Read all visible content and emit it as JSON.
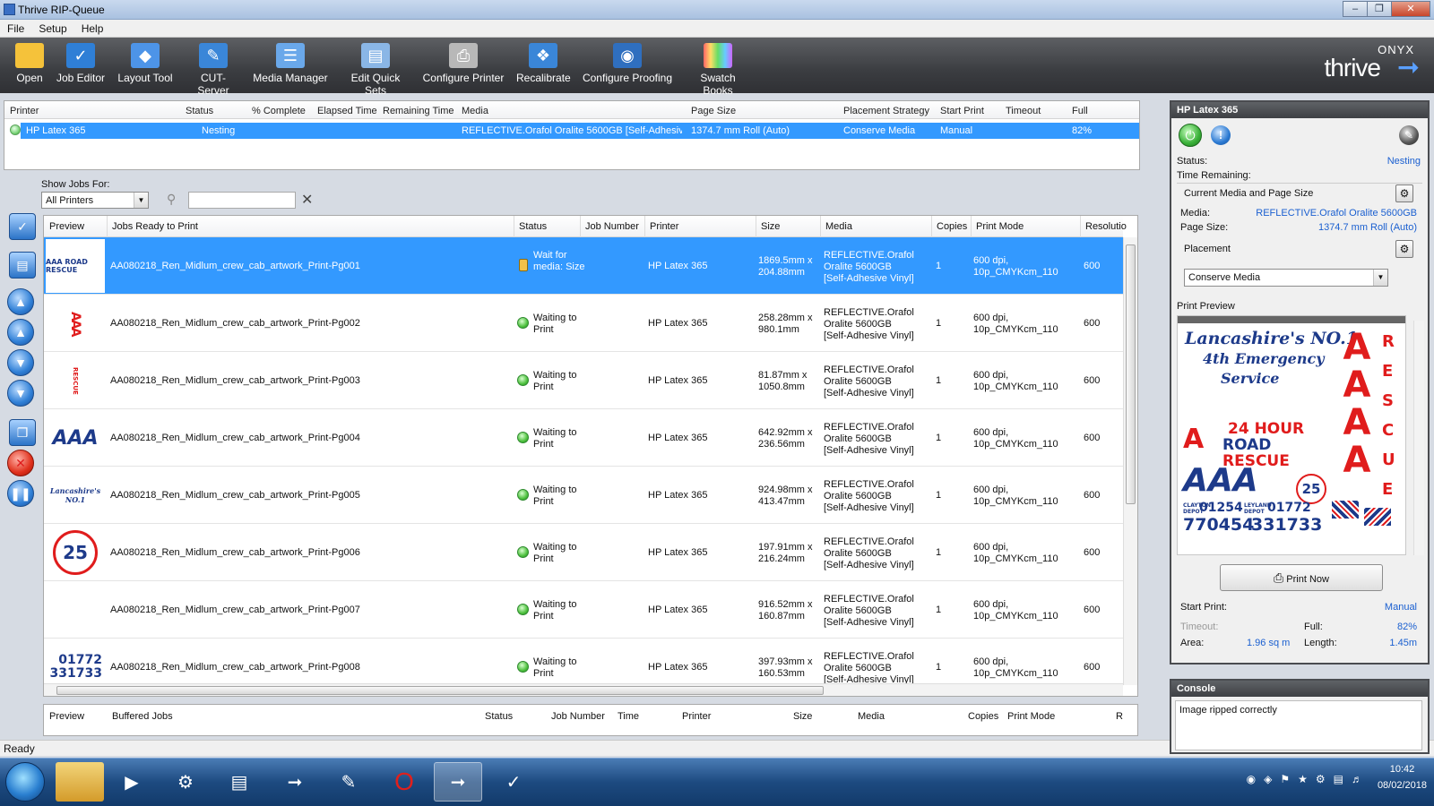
{
  "window": {
    "title": "Thrive RIP-Queue"
  },
  "menu": [
    "File",
    "Setup",
    "Help"
  ],
  "toolbar": [
    {
      "label": "Open",
      "icon": "folder-icon"
    },
    {
      "label": "Job Editor",
      "icon": "job-editor-icon"
    },
    {
      "label": "Layout Tool",
      "icon": "layout-tool-icon"
    },
    {
      "label": "CUT-Server",
      "icon": "cut-server-icon"
    },
    {
      "label": "Media Manager",
      "icon": "media-manager-icon"
    },
    {
      "label": "Edit Quick Sets",
      "icon": "quick-sets-icon"
    },
    {
      "label": "Configure Printer",
      "icon": "printer-icon"
    },
    {
      "label": "Recalibrate",
      "icon": "recalibrate-icon"
    },
    {
      "label": "Configure Proofing",
      "icon": "proofing-eye-icon"
    },
    {
      "label": "Swatch Books",
      "icon": "swatch-grid-icon"
    }
  ],
  "brand": {
    "onyx": "ONYX",
    "thrive": "thrive"
  },
  "printers": {
    "columns": [
      "Printer",
      "Status",
      "% Complete",
      "Elapsed Time",
      "Remaining Time",
      "Media",
      "Page Size",
      "Placement Strategy",
      "Start Print",
      "Timeout",
      "Full"
    ],
    "row": {
      "printer": "HP Latex 365",
      "status": "Nesting",
      "media": "REFLECTIVE.Orafol Oralite 5600GB [Self-Adhesiv...",
      "page_size": "1374.7 mm Roll (Auto)",
      "placement": "Conserve Media",
      "start_print": "Manual",
      "full": "82%"
    }
  },
  "filter": {
    "label": "Show Jobs For:",
    "selected": "All Printers",
    "search_value": ""
  },
  "jobs": {
    "columns": [
      "Preview",
      "Jobs Ready to Print",
      "Status",
      "Job Number",
      "Printer",
      "Size",
      "Media",
      "Copies",
      "Print Mode",
      "Resolutio"
    ],
    "rows": [
      {
        "name": "AA080218_Ren_Midlum_crew_cab_artwork_Print-Pg001",
        "status": "Wait for media: Size",
        "printer": "HP Latex 365",
        "size_1": "1869.5mm x",
        "size_2": "204.88mm",
        "media_1": "REFLECTIVE.Orafol",
        "media_2": "Oralite 5600GB",
        "media_3": "[Self-Adhesive Vinyl]",
        "copies": "1",
        "mode_1": "600 dpi,",
        "mode_2": "10p_CMYKcm_110",
        "resolution": "600",
        "preview": "AAA ROAD RESCUE"
      },
      {
        "name": "AA080218_Ren_Midlum_crew_cab_artwork_Print-Pg002",
        "status_1": "Waiting to",
        "status_2": "Print",
        "printer": "HP Latex 365",
        "size_1": "258.28mm x",
        "size_2": "980.1mm",
        "media_1": "REFLECTIVE.Orafol",
        "media_2": "Oralite 5600GB",
        "media_3": "[Self-Adhesive Vinyl]",
        "copies": "1",
        "mode_1": "600 dpi,",
        "mode_2": "10p_CMYKcm_110",
        "resolution": "600",
        "preview": "AAA"
      },
      {
        "name": "AA080218_Ren_Midlum_crew_cab_artwork_Print-Pg003",
        "status_1": "Waiting to",
        "status_2": "Print",
        "printer": "HP Latex 365",
        "size_1": "81.87mm x",
        "size_2": "1050.8mm",
        "media_1": "REFLECTIVE.Orafol",
        "media_2": "Oralite 5600GB",
        "media_3": "[Self-Adhesive Vinyl]",
        "copies": "1",
        "mode_1": "600 dpi,",
        "mode_2": "10p_CMYKcm_110",
        "resolution": "600",
        "preview": "RESCUE"
      },
      {
        "name": "AA080218_Ren_Midlum_crew_cab_artwork_Print-Pg004",
        "status_1": "Waiting to",
        "status_2": "Print",
        "printer": "HP Latex 365",
        "size_1": "642.92mm x",
        "size_2": "236.56mm",
        "media_1": "REFLECTIVE.Orafol",
        "media_2": "Oralite 5600GB",
        "media_3": "[Self-Adhesive Vinyl]",
        "copies": "1",
        "mode_1": "600 dpi,",
        "mode_2": "10p_CMYKcm_110",
        "resolution": "600",
        "preview": "AAA"
      },
      {
        "name": "AA080218_Ren_Midlum_crew_cab_artwork_Print-Pg005",
        "status_1": "Waiting to",
        "status_2": "Print",
        "printer": "HP Latex 365",
        "size_1": "924.98mm x",
        "size_2": "413.47mm",
        "media_1": "REFLECTIVE.Orafol",
        "media_2": "Oralite 5600GB",
        "media_3": "[Self-Adhesive Vinyl]",
        "copies": "1",
        "mode_1": "600 dpi,",
        "mode_2": "10p_CMYKcm_110",
        "resolution": "600",
        "preview": "Lancashire's NO.1"
      },
      {
        "name": "AA080218_Ren_Midlum_crew_cab_artwork_Print-Pg006",
        "status_1": "Waiting to",
        "status_2": "Print",
        "printer": "HP Latex 365",
        "size_1": "197.91mm x",
        "size_2": "216.24mm",
        "media_1": "REFLECTIVE.Orafol",
        "media_2": "Oralite 5600GB",
        "media_3": "[Self-Adhesive Vinyl]",
        "copies": "1",
        "mode_1": "600 dpi,",
        "mode_2": "10p_CMYKcm_110",
        "resolution": "600",
        "preview": "25"
      },
      {
        "name": "AA080218_Ren_Midlum_crew_cab_artwork_Print-Pg007",
        "status_1": "Waiting to",
        "status_2": "Print",
        "printer": "HP Latex 365",
        "size_1": "916.52mm x",
        "size_2": "160.87mm",
        "media_1": "REFLECTIVE.Orafol",
        "media_2": "Oralite 5600GB",
        "media_3": "[Self-Adhesive Vinyl]",
        "copies": "1",
        "mode_1": "600 dpi,",
        "mode_2": "10p_CMYKcm_110",
        "resolution": "600",
        "preview": ""
      },
      {
        "name": "AA080218_Ren_Midlum_crew_cab_artwork_Print-Pg008",
        "status_1": "Waiting to",
        "status_2": "Print",
        "printer": "HP Latex 365",
        "size_1": "397.93mm x",
        "size_2": "160.53mm",
        "media_1": "REFLECTIVE.Orafol",
        "media_2": "Oralite 5600GB",
        "media_3": "[Self-Adhesive Vinyl]",
        "copies": "1",
        "mode_1": "600 dpi,",
        "mode_2": "10p_CMYKcm_110",
        "resolution": "600",
        "preview": "01772 331733"
      }
    ]
  },
  "buffered": {
    "columns": [
      "Preview",
      "Buffered Jobs",
      "Status",
      "Job Number",
      "Time",
      "Printer",
      "Size",
      "Media",
      "Copies",
      "Print Mode",
      "R"
    ]
  },
  "statusbar": "Ready",
  "right": {
    "title": "HP Latex 365",
    "status_label": "Status:",
    "status_value": "Nesting",
    "time_label": "Time Remaining:",
    "media_section": "Current Media and Page Size",
    "media_label": "Media:",
    "media_value": "REFLECTIVE.Orafol Oralite 5600GB",
    "page_label": "Page Size:",
    "page_value": "1374.7 mm Roll (Auto)",
    "placement_label": "Placement",
    "placement_value": "Conserve Media",
    "preview_label": "Print Preview",
    "print_now": "Print Now",
    "start_label": "Start Print:",
    "start_value": "Manual",
    "timeout_label": "Timeout:",
    "full_label": "Full:",
    "full_value": "82%",
    "area_label": "Area:",
    "area_value": "1.96 sq m",
    "length_label": "Length:",
    "length_value": "1.45m"
  },
  "preview_art": {
    "line1": "Lancashire's NO.1",
    "line2": "4th Emergency",
    "line3": "Service",
    "hours": "24 HOUR",
    "road": "ROAD",
    "rescue": "RESCUE",
    "aaa": "AAA",
    "years": "25",
    "depot1": "CLAYTON DEPOT",
    "phone1": "01254",
    "num1": "770454",
    "depot2": "LEYLAND DEPOT",
    "phone2": "01772",
    "num2": "331733",
    "vertical": "RESCUE"
  },
  "console": {
    "title": "Console",
    "message": "Image ripped correctly"
  },
  "clock": {
    "time": "10:42",
    "date": "08/02/2018"
  },
  "colors": {
    "selection": "#3399ff",
    "link": "#1a5fd0",
    "toolbar": "#3b3d41"
  }
}
